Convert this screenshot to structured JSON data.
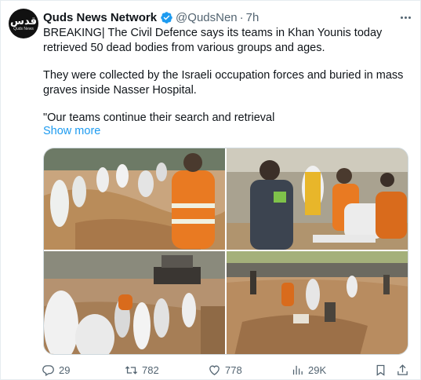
{
  "tweet": {
    "account": {
      "name": "Quds News Network",
      "handle": "@QudsNen",
      "separator": "·",
      "time": "7h",
      "avatar_logo_text": "قدس",
      "avatar_sub_text": "Quds News"
    },
    "text": {
      "paragraph1": "BREAKING| The Civil Defence says its teams in Khan Younis today retrieved 50 dead bodies from various groups and ages.",
      "paragraph2": "They were collected by the Israeli occupation forces and buried in mass graves inside Nasser Hospital.",
      "paragraph3": "\"Our teams continue their search and retrieval",
      "show_more": "Show more"
    },
    "media_count": 4,
    "stats": {
      "replies": "29",
      "reposts": "782",
      "likes": "778",
      "views": "29K"
    }
  },
  "colors": {
    "accent": "#1d9bf0",
    "muted_text": "#536471",
    "primary_text": "#0f1419",
    "border": "#cfd9de"
  },
  "icons": {
    "verified": "verified-badge-icon",
    "more": "more-options-icon",
    "reply": "reply-icon",
    "repost": "repost-icon",
    "like": "heart-icon",
    "views": "views-bar-chart-icon",
    "bookmark": "bookmark-icon",
    "share": "share-icon"
  }
}
